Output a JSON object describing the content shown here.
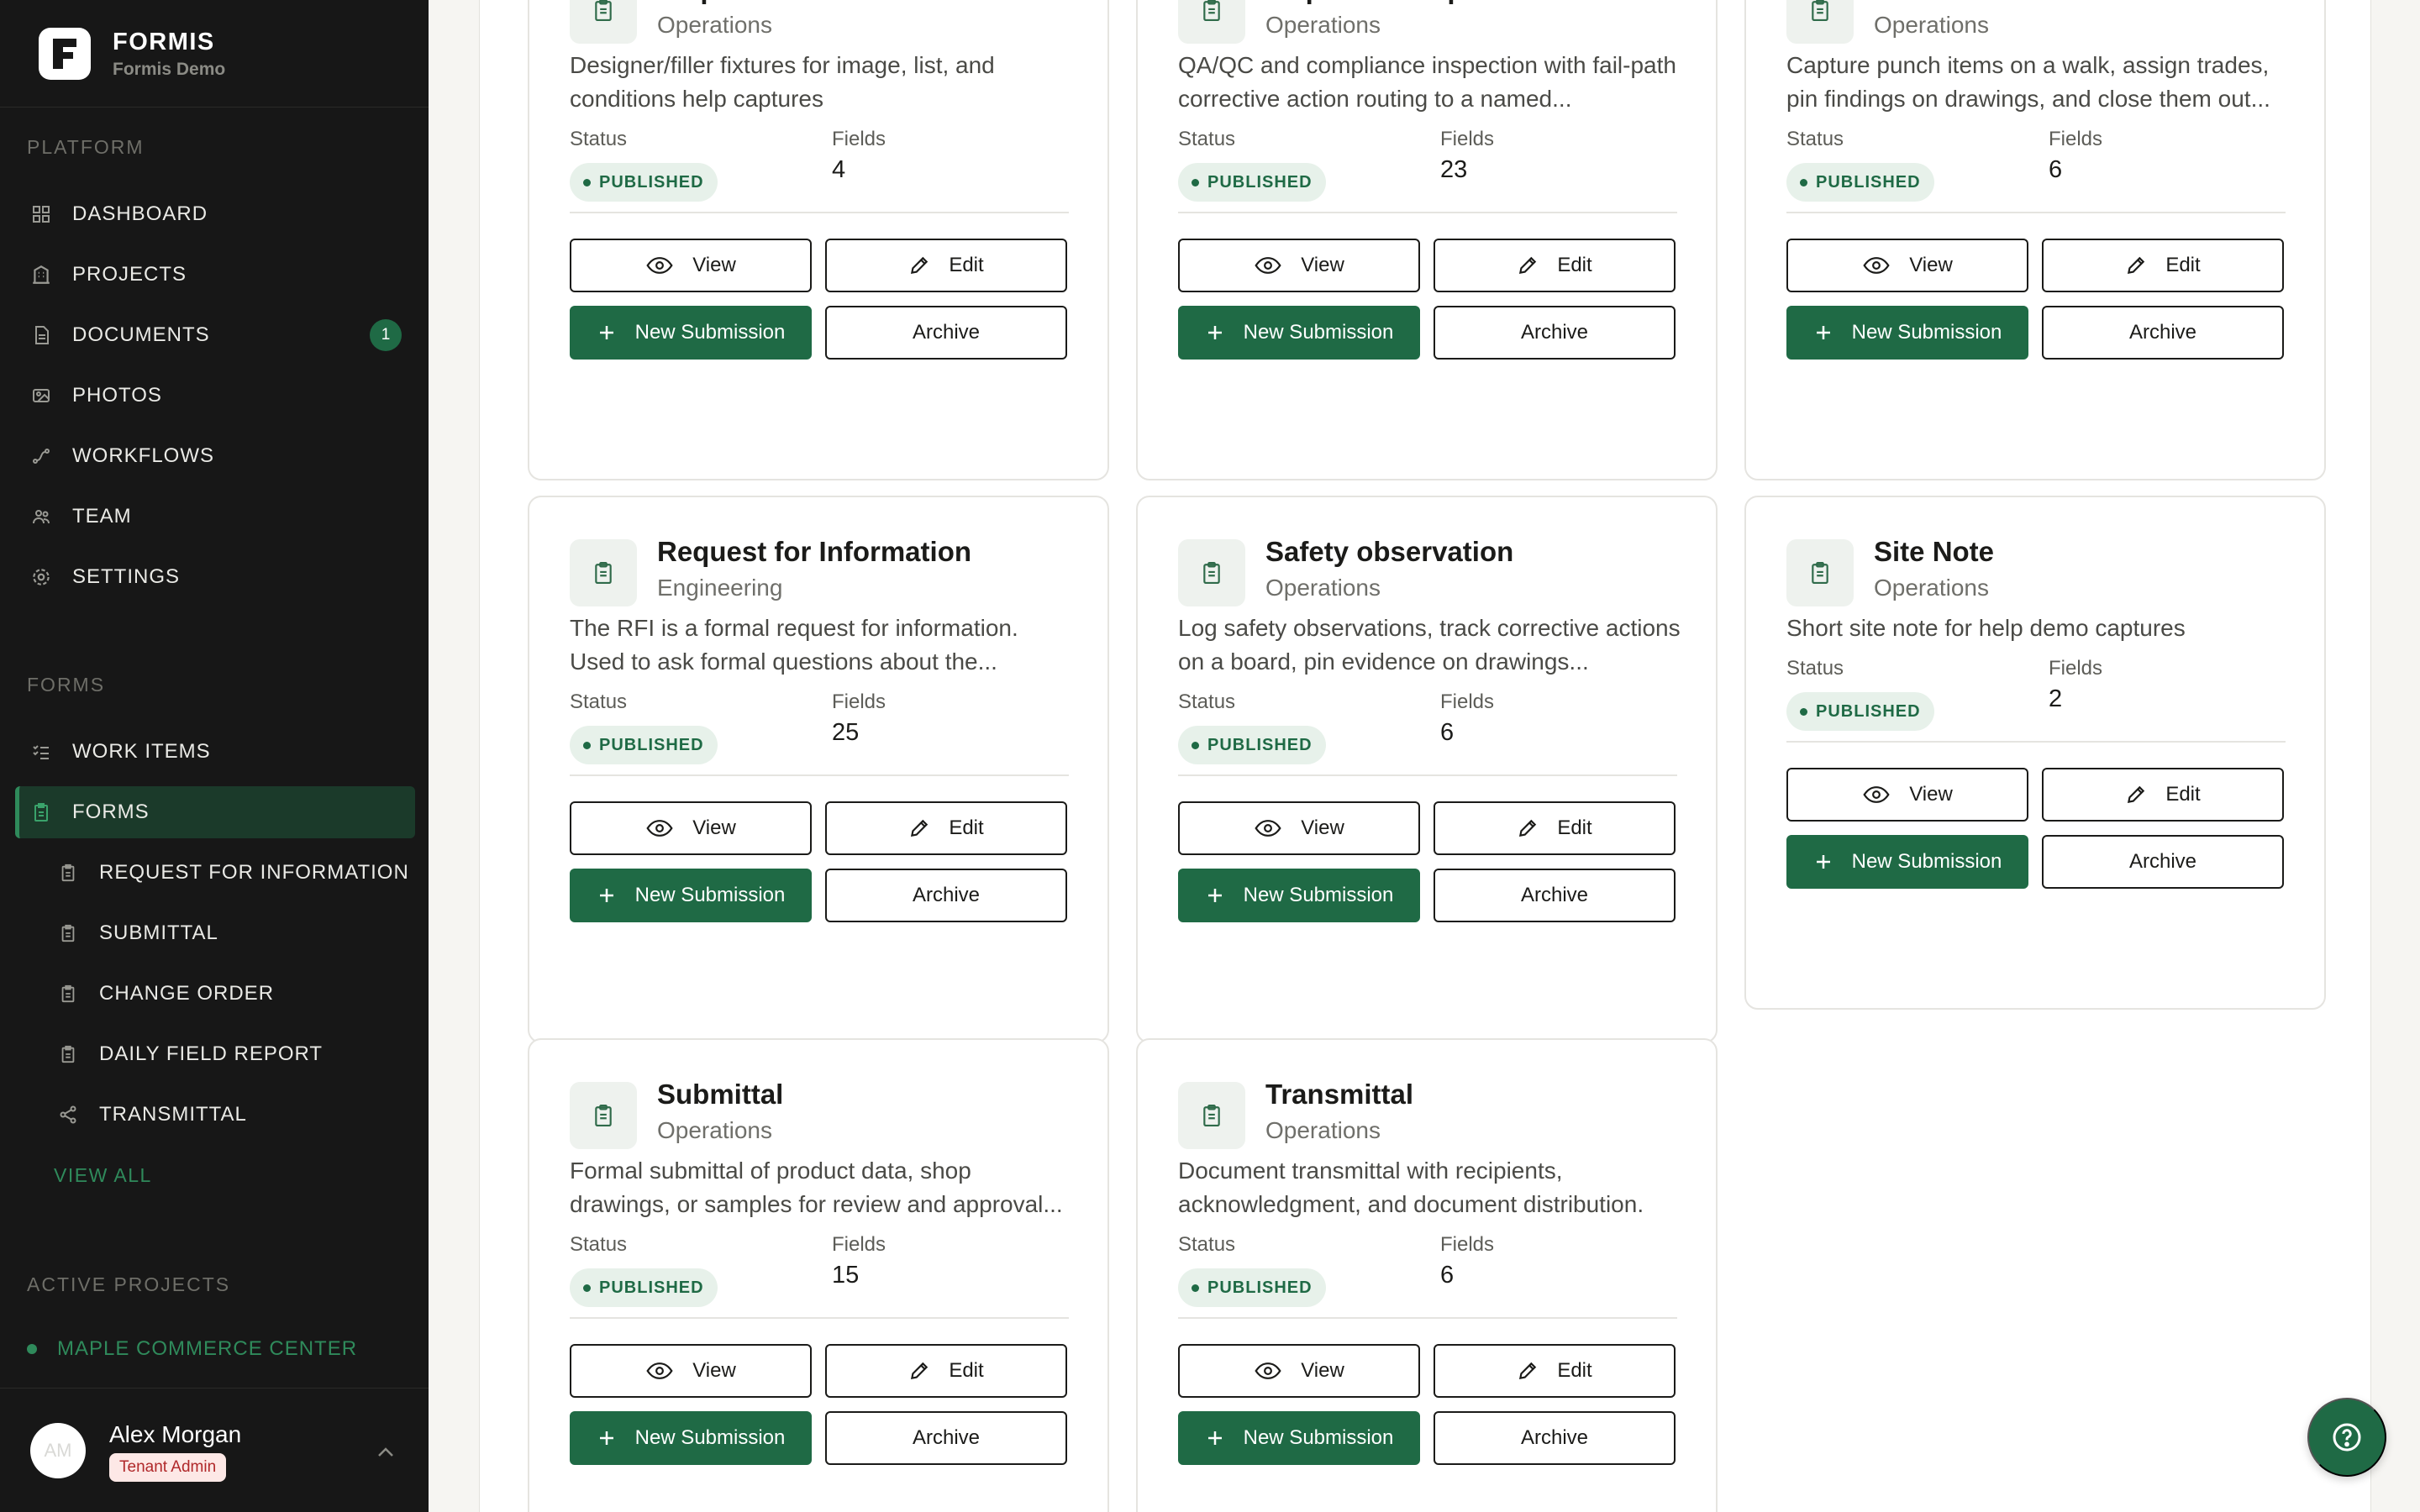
{
  "brand": {
    "name": "FORMIS",
    "subtitle": "Formis Demo"
  },
  "sidebar": {
    "platform_label": "PLATFORM",
    "platform_items": [
      {
        "label": "DASHBOARD",
        "icon": "grid-icon"
      },
      {
        "label": "PROJECTS",
        "icon": "building-icon"
      },
      {
        "label": "DOCUMENTS",
        "icon": "document-icon",
        "badge": "1"
      },
      {
        "label": "PHOTOS",
        "icon": "photos-icon"
      },
      {
        "label": "WORKFLOWS",
        "icon": "workflow-icon"
      },
      {
        "label": "TEAM",
        "icon": "team-icon"
      },
      {
        "label": "SETTINGS",
        "icon": "gear-icon"
      }
    ],
    "forms_label": "FORMS",
    "forms_items": [
      {
        "label": "WORK ITEMS",
        "icon": "list-icon"
      },
      {
        "label": "FORMS",
        "icon": "clipboard-icon",
        "active": true
      }
    ],
    "form_subitems": [
      {
        "label": "REQUEST FOR INFORMATION",
        "icon": "clipboard-icon"
      },
      {
        "label": "SUBMITTAL",
        "icon": "clipboard-icon"
      },
      {
        "label": "CHANGE ORDER",
        "icon": "clipboard-icon"
      },
      {
        "label": "DAILY FIELD REPORT",
        "icon": "clipboard-icon"
      },
      {
        "label": "TRANSMITTAL",
        "icon": "share-icon"
      }
    ],
    "view_all": "VIEW ALL",
    "projects_label": "ACTIVE PROJECTS",
    "project": "MAPLE COMMERCE CENTER",
    "user": {
      "initials": "AM",
      "name": "Alex Morgan",
      "role": "Tenant Admin"
    }
  },
  "labels": {
    "status": "Status",
    "fields": "Fields",
    "published": "PUBLISHED",
    "view": "View",
    "edit": "Edit",
    "new_submission": "New Submission",
    "archive": "Archive"
  },
  "cards": [
    {
      "title": "Help Form Elements",
      "category": "Operations",
      "description": "Designer/filler fixtures for image, list, and conditions help captures",
      "fields": "4"
    },
    {
      "title": "Inspection Report",
      "category": "Operations",
      "description": "QA/QC and compliance inspection with fail-path corrective action routing to a named...",
      "fields": "23"
    },
    {
      "title": "Punch list",
      "category": "Operations",
      "description": "Capture punch items on a walk, assign trades, pin findings on drawings, and close them out...",
      "fields": "6"
    },
    {
      "title": "Request for Information",
      "category": "Engineering",
      "description": "The RFI is a formal request for information. Used to ask formal questions about the...",
      "fields": "25"
    },
    {
      "title": "Safety observation",
      "category": "Operations",
      "description": "Log safety observations, track corrective actions on a board, pin evidence on drawings...",
      "fields": "6"
    },
    {
      "title": "Site Note",
      "category": "Operations",
      "description": "Short site note for help demo captures",
      "fields": "2"
    },
    {
      "title": "Submittal",
      "category": "Operations",
      "description": "Formal submittal of product data, shop drawings, or samples for review and approval...",
      "fields": "15"
    },
    {
      "title": "Transmittal",
      "category": "Operations",
      "description": "Document transmittal with recipients, acknowledgment, and document distribution.",
      "fields": "6"
    }
  ],
  "colors": {
    "accent": "#1f6a45",
    "sidebar_bg": "#171717",
    "badge_bg": "#e7f1ea"
  }
}
